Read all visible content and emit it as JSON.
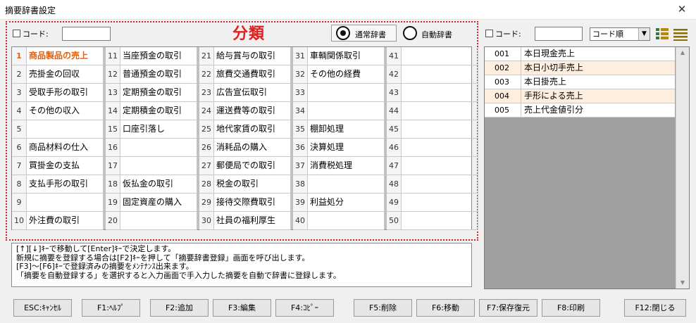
{
  "window": {
    "title": "摘要辞書設定",
    "close_glyph": "✕"
  },
  "left": {
    "heading": "分類",
    "code_label": "コード:",
    "code_value": "",
    "radio_normal": "通常辞書",
    "radio_auto": "自動辞書",
    "radio_selected": "normal"
  },
  "categories": [
    {
      "no": "1",
      "label": "商品製品の売上",
      "selected": true
    },
    {
      "no": "2",
      "label": "売掛金の回収"
    },
    {
      "no": "3",
      "label": "受取手形の取引"
    },
    {
      "no": "4",
      "label": "その他の収入"
    },
    {
      "no": "5",
      "label": ""
    },
    {
      "no": "6",
      "label": "商品材料の仕入"
    },
    {
      "no": "7",
      "label": "買掛金の支払"
    },
    {
      "no": "8",
      "label": "支払手形の取引"
    },
    {
      "no": "9",
      "label": ""
    },
    {
      "no": "10",
      "label": "外注費の取引"
    },
    {
      "no": "11",
      "label": "当座預金の取引"
    },
    {
      "no": "12",
      "label": "普通預金の取引"
    },
    {
      "no": "13",
      "label": "定期預金の取引"
    },
    {
      "no": "14",
      "label": "定期積金の取引"
    },
    {
      "no": "15",
      "label": "口座引落し"
    },
    {
      "no": "16",
      "label": ""
    },
    {
      "no": "17",
      "label": ""
    },
    {
      "no": "18",
      "label": "仮払金の取引"
    },
    {
      "no": "19",
      "label": "固定資産の購入"
    },
    {
      "no": "20",
      "label": ""
    },
    {
      "no": "21",
      "label": "給与賞与の取引"
    },
    {
      "no": "22",
      "label": "旅費交通費取引"
    },
    {
      "no": "23",
      "label": "広告宣伝取引"
    },
    {
      "no": "24",
      "label": "運送費等の取引"
    },
    {
      "no": "25",
      "label": "地代家賃の取引"
    },
    {
      "no": "26",
      "label": "消耗品の購入"
    },
    {
      "no": "27",
      "label": "郵便局での取引"
    },
    {
      "no": "28",
      "label": "税金の取引"
    },
    {
      "no": "29",
      "label": "接待交際費取引"
    },
    {
      "no": "30",
      "label": "社員の福利厚生"
    },
    {
      "no": "31",
      "label": "車輌関係取引"
    },
    {
      "no": "32",
      "label": "その他の経費"
    },
    {
      "no": "33",
      "label": ""
    },
    {
      "no": "34",
      "label": ""
    },
    {
      "no": "35",
      "label": "棚卸処理"
    },
    {
      "no": "36",
      "label": "決算処理"
    },
    {
      "no": "37",
      "label": "消費税処理"
    },
    {
      "no": "38",
      "label": ""
    },
    {
      "no": "39",
      "label": "利益処分"
    },
    {
      "no": "40",
      "label": ""
    },
    {
      "no": "41",
      "label": ""
    },
    {
      "no": "42",
      "label": ""
    },
    {
      "no": "43",
      "label": ""
    },
    {
      "no": "44",
      "label": ""
    },
    {
      "no": "45",
      "label": ""
    },
    {
      "no": "46",
      "label": ""
    },
    {
      "no": "47",
      "label": ""
    },
    {
      "no": "48",
      "label": ""
    },
    {
      "no": "49",
      "label": ""
    },
    {
      "no": "50",
      "label": ""
    }
  ],
  "help_lines": [
    "[↑][↓]ｷｰで移動して[Enter]ｷｰで決定します。",
    "新規に摘要を登録する場合は[F2]ｷｰを押して「摘要辞書登録」画面を呼び出します。",
    "[F3]～[F6]ｷｰで登録済みの摘要をﾒﾝﾃﾅﾝｽ出来ます。",
    "「摘要を自動登録する」を選択すると入力画面で手入力した摘要を自動で辞書に登録します。"
  ],
  "right": {
    "code_label": "コード:",
    "code_value": "",
    "sort_value": "コード順",
    "sort_arrow": "▼",
    "view_icons": [
      "grid-view-icon",
      "list-view-icon"
    ],
    "entries": [
      {
        "code": "001",
        "name": "本日現金売上"
      },
      {
        "code": "002",
        "name": "本日小切手売上"
      },
      {
        "code": "003",
        "name": "本日掛売上"
      },
      {
        "code": "004",
        "name": "手形による売上"
      },
      {
        "code": "005",
        "name": "売上代金値引分"
      }
    ]
  },
  "buttons": [
    {
      "key": "esc",
      "label": "ESC:ｷｬﾝｾﾙ"
    },
    {
      "key": "f1",
      "label": "F1:ﾍﾙﾌﾟ"
    },
    {
      "key": "f2",
      "label": "F2:追加"
    },
    {
      "key": "f3",
      "label": "F3:編集"
    },
    {
      "key": "f4",
      "label": "F4:ｺﾋﾟｰ"
    },
    {
      "key": "f5",
      "label": "F5:削除"
    },
    {
      "key": "f6",
      "label": "F6:移動"
    },
    {
      "key": "f7",
      "label": "F7:保存復元"
    },
    {
      "key": "f8",
      "label": "F8:印刷"
    },
    {
      "key": "f12",
      "label": "F12:閉じる"
    }
  ],
  "colors": {
    "accent_red": "#e02020",
    "selected_orange": "#e06010",
    "row_alt": "#fdeedd",
    "list_bg": "#a0a0a0",
    "icon_green": "#2e7d32",
    "icon_gold": "#b8860b"
  }
}
